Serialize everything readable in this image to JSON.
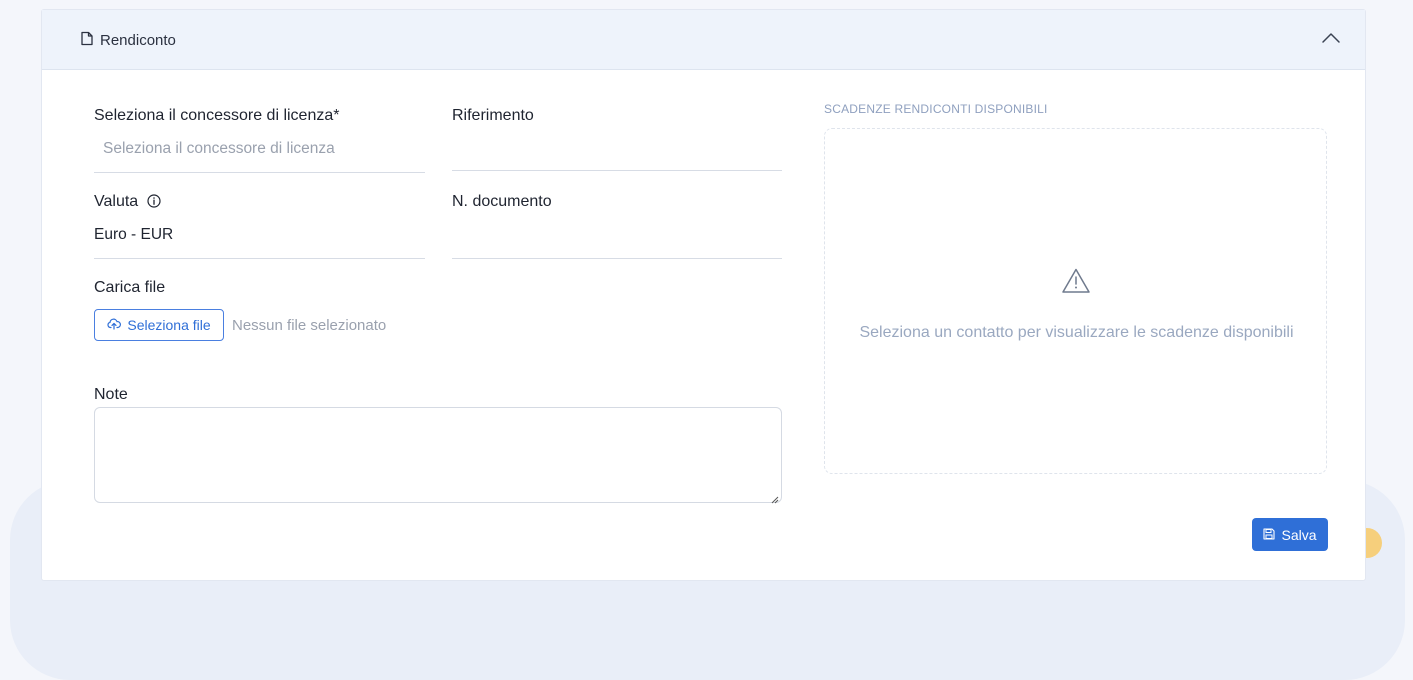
{
  "card": {
    "title": "Rendiconto",
    "title_icon": "document-icon",
    "collapse_icon": "chevron-up-icon"
  },
  "form": {
    "licensor": {
      "label": "Seleziona il concessore di licenza*",
      "placeholder": "Seleziona il concessore di licenza"
    },
    "reference": {
      "label": "Riferimento",
      "value": ""
    },
    "currency": {
      "label": "Valuta",
      "value": "Euro - EUR",
      "info_icon": "info-icon"
    },
    "doc_number": {
      "label": "N. documento",
      "value": ""
    },
    "upload": {
      "label": "Carica file",
      "button_label": "Seleziona file",
      "button_icon": "upload-icon",
      "status": "Nessun file selezionato"
    },
    "notes": {
      "label": "Note",
      "value": ""
    }
  },
  "side": {
    "title": "SCADENZE RENDICONTI DISPONIBILI",
    "icon": "warning-icon",
    "message": "Seleziona un contatto per visualizzare le scadenze disponibili"
  },
  "actions": {
    "save_label": "Salva",
    "save_icon": "floppy-disk-icon"
  },
  "colors": {
    "accent": "#2f6fd7",
    "header_bg": "#eef3fb",
    "muted": "#9aa1ae"
  }
}
